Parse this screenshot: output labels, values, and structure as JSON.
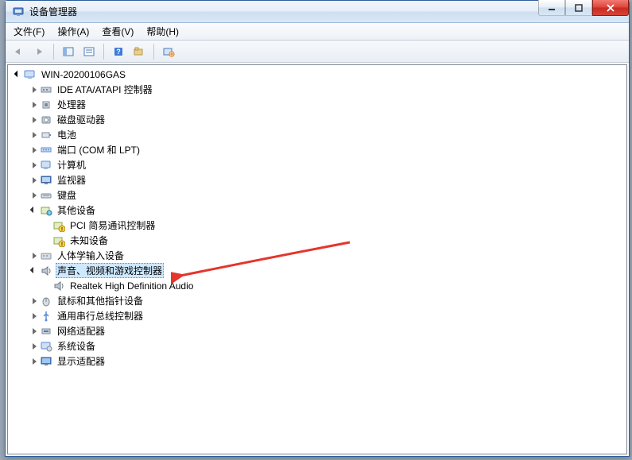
{
  "window": {
    "title": "设备管理器"
  },
  "menu": {
    "file": "文件(F)",
    "action": "操作(A)",
    "view": "查看(V)",
    "help": "帮助(H)"
  },
  "tree": {
    "root": "WIN-20200106GAS",
    "items": [
      {
        "label": "IDE ATA/ATAPI 控制器",
        "icon": "ide"
      },
      {
        "label": "处理器",
        "icon": "cpu"
      },
      {
        "label": "磁盘驱动器",
        "icon": "disk"
      },
      {
        "label": "电池",
        "icon": "battery"
      },
      {
        "label": "端口 (COM 和 LPT)",
        "icon": "port"
      },
      {
        "label": "计算机",
        "icon": "computer"
      },
      {
        "label": "监视器",
        "icon": "monitor"
      },
      {
        "label": "键盘",
        "icon": "keyboard"
      }
    ],
    "other_devices": {
      "label": "其他设备",
      "children": [
        {
          "label": "PCI 简易通讯控制器"
        },
        {
          "label": "未知设备"
        }
      ]
    },
    "hid": {
      "label": "人体学输入设备"
    },
    "sound": {
      "label": "声音、视频和游戏控制器",
      "child": "Realtek High Definition Audio"
    },
    "tail": [
      {
        "label": "鼠标和其他指针设备",
        "icon": "mouse"
      },
      {
        "label": "通用串行总线控制器",
        "icon": "usb"
      },
      {
        "label": "网络适配器",
        "icon": "network"
      },
      {
        "label": "系统设备",
        "icon": "system"
      },
      {
        "label": "显示适配器",
        "icon": "display"
      }
    ]
  }
}
